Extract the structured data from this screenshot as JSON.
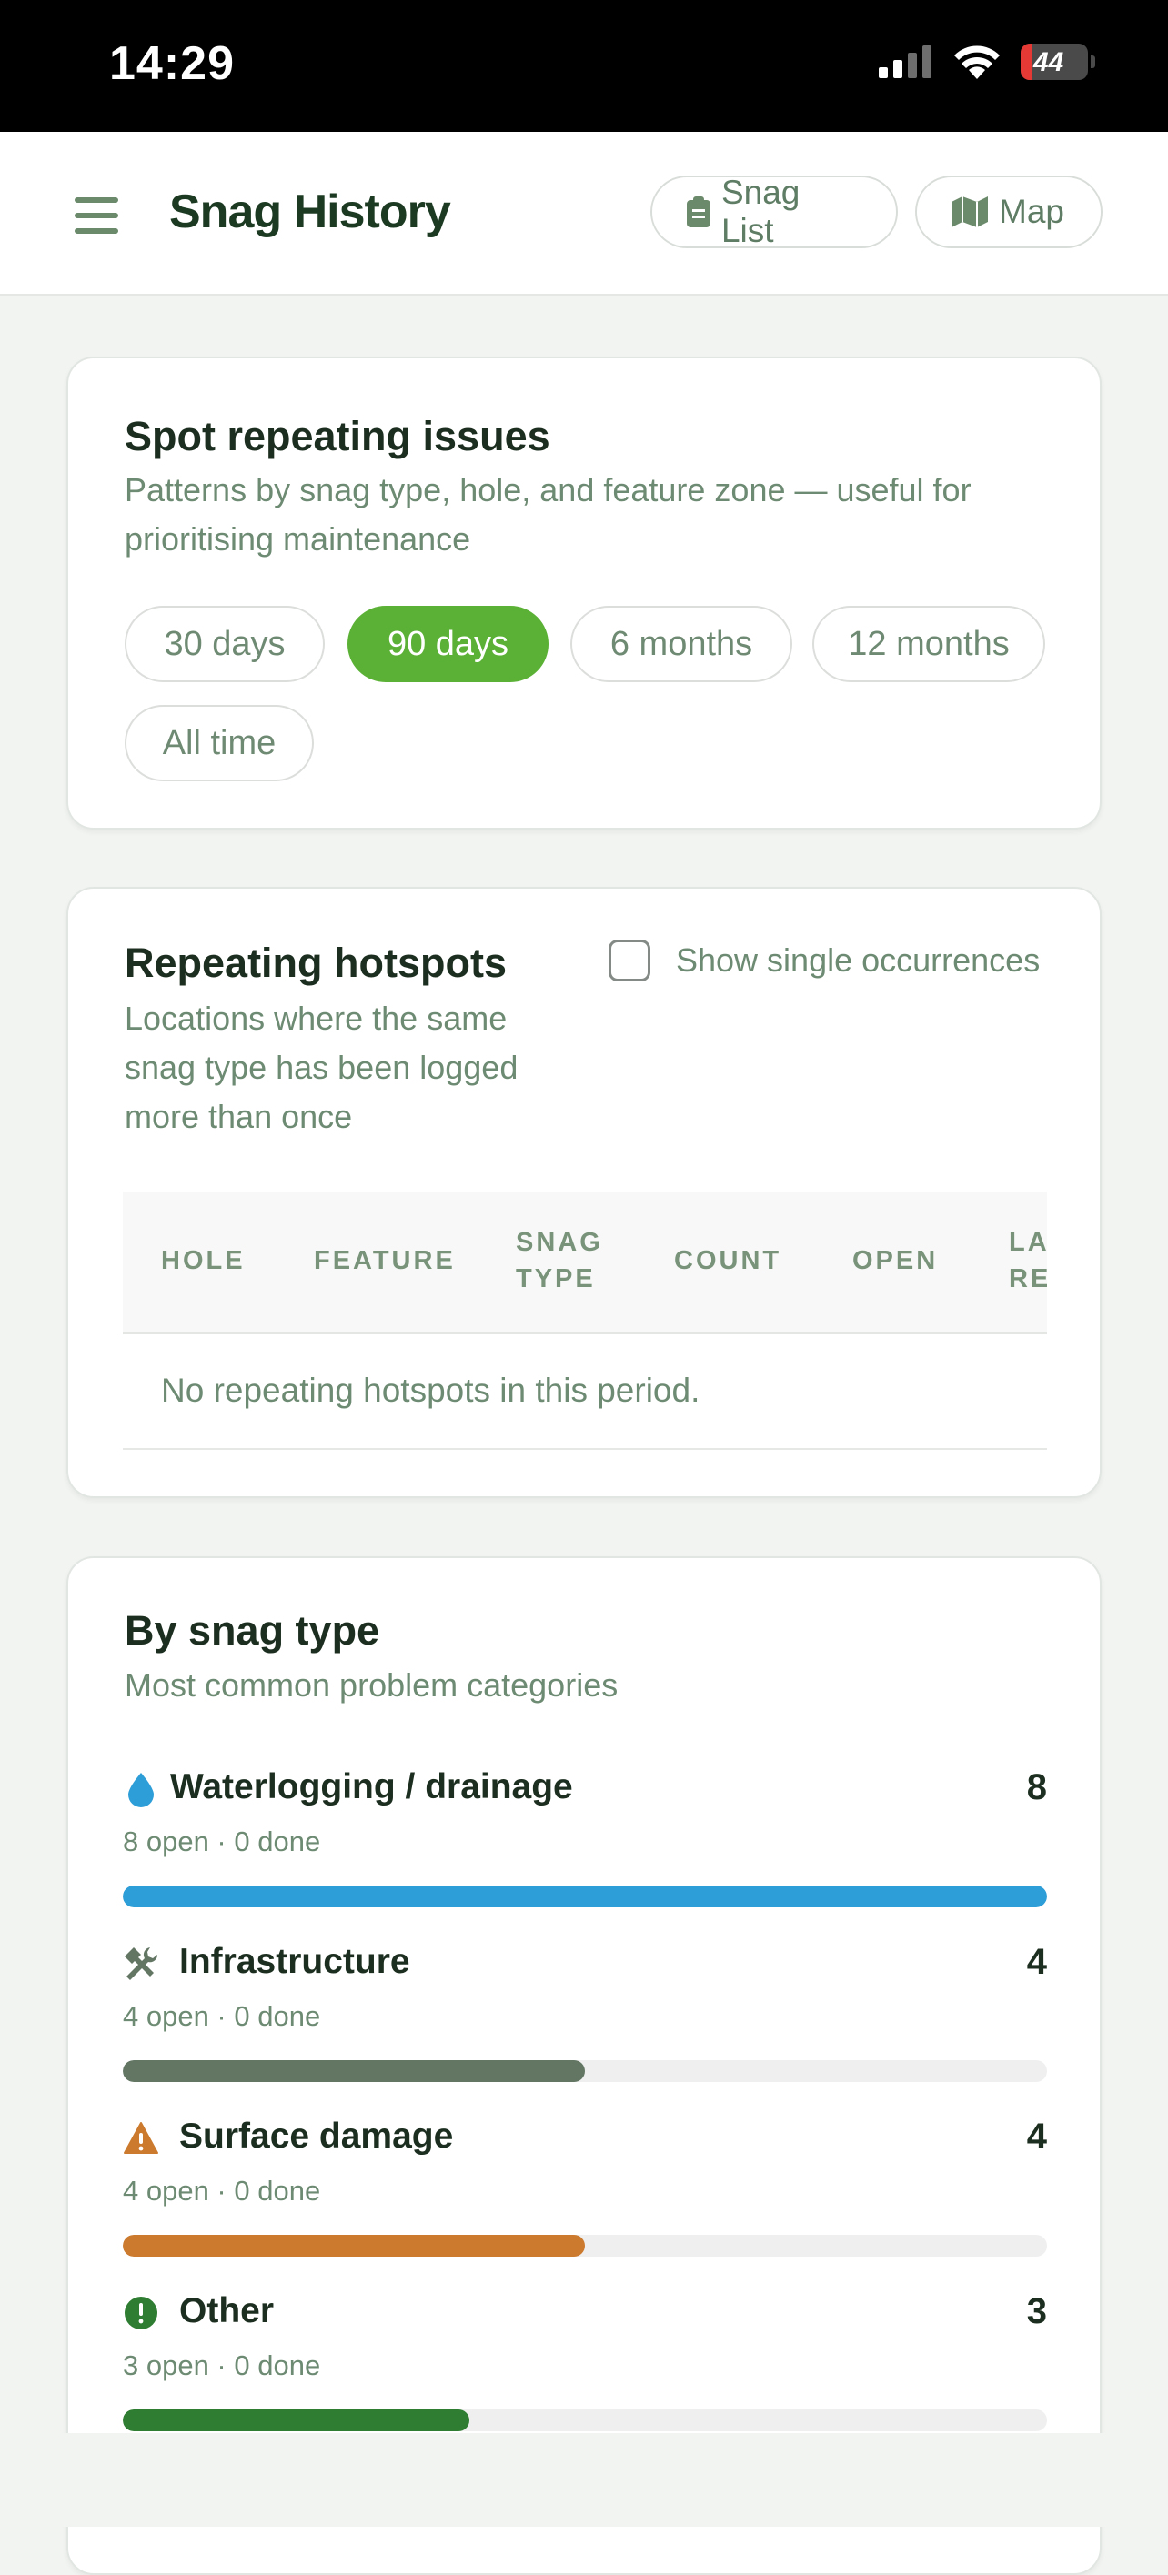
{
  "status_bar": {
    "time": "14:29",
    "battery": "44"
  },
  "header": {
    "title": "Snag History",
    "snag_list_label": "Snag List",
    "map_label": "Map"
  },
  "period_card": {
    "title": "Spot repeating issues",
    "subtitle_line1": "Patterns by snag type, hole, and feature zone — useful for",
    "subtitle_line2": "prioritising maintenance",
    "filters": [
      "30 days",
      "90 days",
      "6 months",
      "12 months",
      "All time"
    ],
    "selected_filter": "90 days"
  },
  "hotspots_card": {
    "title": "Repeating hotspots",
    "subtitle_lines": [
      "Locations where the same",
      "snag type has been logged",
      "more than once"
    ],
    "checkbox_label": "Show single occurrences",
    "checkbox_checked": false,
    "columns": {
      "hole": "HOLE",
      "feature": "FEATURE",
      "snag_type_1": "SNAG",
      "snag_type_2": "TYPE",
      "count": "COUNT",
      "open": "OPEN",
      "last_1": "LA",
      "last_2": "RE"
    },
    "empty_message": "No repeating hotspots in this period."
  },
  "type_card": {
    "title": "By snag type",
    "subtitle": "Most common problem categories",
    "items": [
      {
        "name": "Waterlogging / drainage",
        "count": "8",
        "meta": "8 open · 0 done",
        "share": 1.0,
        "color": "#2e9ed8",
        "icon": "water-drop-icon"
      },
      {
        "name": "Infrastructure",
        "count": "4",
        "meta": "4 open · 0 done",
        "share": 0.5,
        "color": "#627663",
        "icon": "tools-icon"
      },
      {
        "name": "Surface damage",
        "count": "4",
        "meta": "4 open · 0 done",
        "share": 0.5,
        "color": "#cc7a2e",
        "icon": "warning-icon"
      },
      {
        "name": "Other",
        "count": "3",
        "meta": "3 open · 0 done",
        "share": 0.375,
        "color": "#2e7d32",
        "icon": "alert-circle-icon"
      }
    ]
  }
}
